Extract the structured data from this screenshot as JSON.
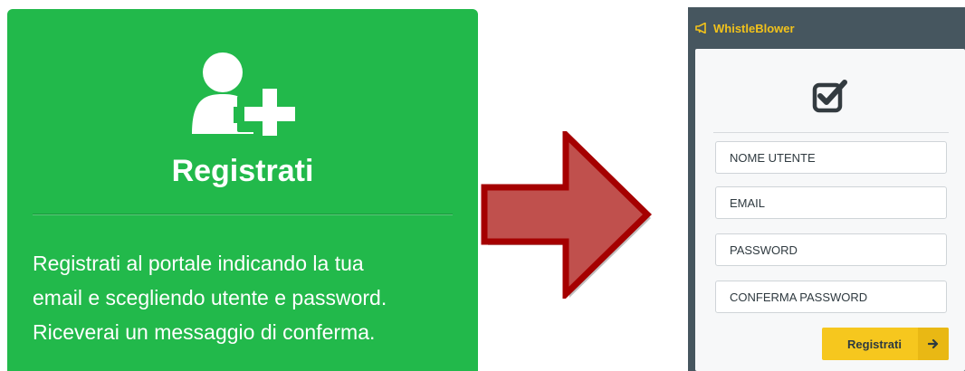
{
  "colors": {
    "card_bg": "#22b94b",
    "app_bg": "#46565f",
    "accent": "#f6c71e",
    "arrow_fill": "#c0504d",
    "arrow_border": "#a50000"
  },
  "card": {
    "icon": "user-plus-icon",
    "title": "Registrati",
    "description_lines": [
      "Registrati al portale indicando la tua",
      "email e scegliendo utente e password.",
      "Riceverai un messaggio di conferma."
    ]
  },
  "arrow": {
    "icon": "right-arrow-icon"
  },
  "app": {
    "header": {
      "icon": "megaphone-icon",
      "title": "WhistleBlower"
    },
    "panel": {
      "icon": "checkbox-checked-icon",
      "fields": [
        {
          "placeholder": "NOME UTENTE",
          "value": ""
        },
        {
          "placeholder": "EMAIL",
          "value": ""
        },
        {
          "placeholder": "PASSWORD",
          "value": ""
        },
        {
          "placeholder": "CONFERMA PASSWORD",
          "value": ""
        }
      ],
      "submit": {
        "label": "Registrati",
        "icon": "arrow-right-icon"
      }
    }
  }
}
